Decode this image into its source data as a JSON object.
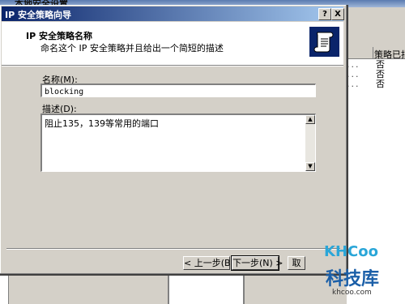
{
  "background_window": {
    "title": "本地安全设置",
    "column_header": "策略已指",
    "rows": [
      {
        "dots": "...",
        "value": "否"
      },
      {
        "dots": "...",
        "value": "否"
      },
      {
        "dots": "...",
        "value": "否"
      }
    ]
  },
  "dialog": {
    "title": "IP 安全策略向导",
    "help_button": "?",
    "close_button": "X",
    "header_title": "IP 安全策略名称",
    "header_subtitle": "命名这个 IP 安全策略并且给出一个简短的描述",
    "name_label": "名称(M):",
    "name_value": "blocking",
    "description_label": "描述(D):",
    "description_value": "阻止135，139等常用的端口",
    "back_button": "< 上一步(B)",
    "next_button": "下一步(N) >",
    "cancel_button": "取"
  },
  "watermark": {
    "logo": "KHCoo",
    "site_name": "科技库",
    "url": "khcoo.com"
  },
  "colors": {
    "titlebar_start": "#0a246a",
    "titlebar_end": "#a6caf0",
    "face": "#d4d0c8"
  }
}
